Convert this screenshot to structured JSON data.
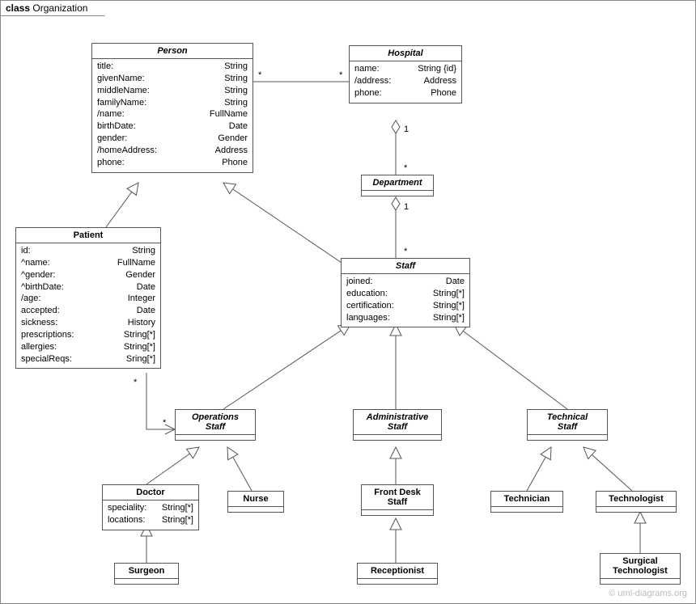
{
  "frame": {
    "kw": "class",
    "name": "Organization"
  },
  "watermark": "© uml-diagrams.org",
  "classes": {
    "person": {
      "name": "Person",
      "attrs": [
        [
          "title:",
          "String"
        ],
        [
          "givenName:",
          "String"
        ],
        [
          "middleName:",
          "String"
        ],
        [
          "familyName:",
          "String"
        ],
        [
          "/name:",
          "FullName"
        ],
        [
          "birthDate:",
          "Date"
        ],
        [
          "gender:",
          "Gender"
        ],
        [
          "/homeAddress:",
          "Address"
        ],
        [
          "phone:",
          "Phone"
        ]
      ]
    },
    "hospital": {
      "name": "Hospital",
      "attrs": [
        [
          "name:",
          "String {id}"
        ],
        [
          "/address:",
          "Address"
        ],
        [
          "phone:",
          "Phone"
        ]
      ]
    },
    "department": {
      "name": "Department"
    },
    "patient": {
      "name": "Patient",
      "attrs": [
        [
          "id:",
          "String"
        ],
        [
          "^name:",
          "FullName"
        ],
        [
          "^gender:",
          "Gender"
        ],
        [
          "^birthDate:",
          "Date"
        ],
        [
          "/age:",
          "Integer"
        ],
        [
          "accepted:",
          "Date"
        ],
        [
          "sickness:",
          "History"
        ],
        [
          "prescriptions:",
          "String[*]"
        ],
        [
          "allergies:",
          "String[*]"
        ],
        [
          "specialReqs:",
          "Sring[*]"
        ]
      ]
    },
    "staff": {
      "name": "Staff",
      "attrs": [
        [
          "joined:",
          "Date"
        ],
        [
          "education:",
          "String[*]"
        ],
        [
          "certification:",
          "String[*]"
        ],
        [
          "languages:",
          "String[*]"
        ]
      ]
    },
    "opstaff": {
      "name": "Operations",
      "line2": "Staff"
    },
    "admstaff": {
      "name": "Administrative",
      "line2": "Staff"
    },
    "techstaff": {
      "name": "Technical",
      "line2": "Staff"
    },
    "doctor": {
      "name": "Doctor",
      "attrs": [
        [
          "speciality:",
          "String[*]"
        ],
        [
          "locations:",
          "String[*]"
        ]
      ]
    },
    "nurse": {
      "name": "Nurse"
    },
    "frontdesk": {
      "name": "Front Desk",
      "line2": "Staff"
    },
    "technician": {
      "name": "Technician"
    },
    "technologist": {
      "name": "Technologist"
    },
    "surgeon": {
      "name": "Surgeon"
    },
    "receptionist": {
      "name": "Receptionist"
    },
    "surgtech": {
      "name": "Surgical",
      "line2": "Technologist"
    }
  },
  "mults": {
    "person_assoc_l": "*",
    "person_assoc_r": "*",
    "hosp_dept_1": "1",
    "hosp_dept_star": "*",
    "dept_staff_1": "1",
    "dept_staff_star": "*",
    "patient_star": "*",
    "opstaff_star": "*"
  }
}
